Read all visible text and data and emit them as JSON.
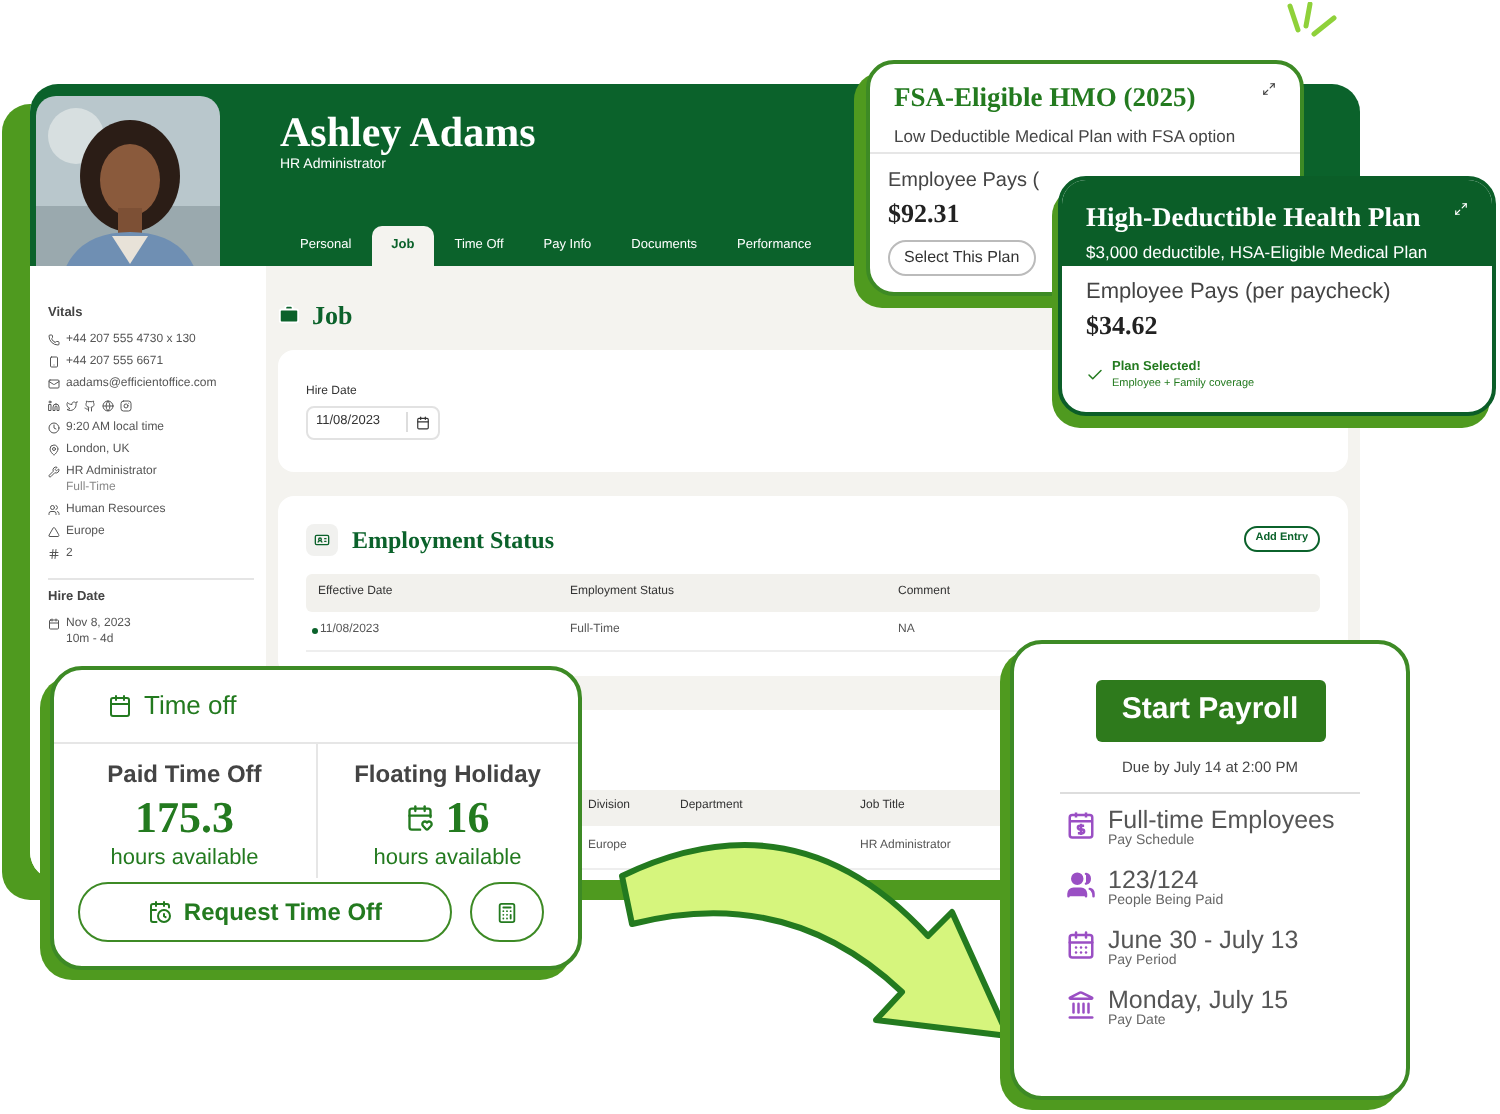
{
  "profile": {
    "name": "Ashley Adams",
    "title": "HR Administrator"
  },
  "tabs": [
    {
      "label": "Personal",
      "selected": false
    },
    {
      "label": "Job",
      "selected": true
    },
    {
      "label": "Time Off",
      "selected": false
    },
    {
      "label": "Pay Info",
      "selected": false
    },
    {
      "label": "Documents",
      "selected": false
    },
    {
      "label": "Performance",
      "selected": false
    }
  ],
  "sidebar": {
    "vitals_heading": "Vitals",
    "vitals": [
      {
        "kind": "phone",
        "lines": [
          "+44 207 555 4730 x 130"
        ]
      },
      {
        "kind": "mobile",
        "lines": [
          "+44 207 555 6671"
        ]
      },
      {
        "kind": "email",
        "lines": [
          "aadams@efficientoffice.com"
        ]
      },
      {
        "kind": "social"
      },
      {
        "kind": "clock",
        "lines": [
          "9:20 AM local time"
        ]
      },
      {
        "kind": "location",
        "lines": [
          "London, UK"
        ]
      },
      {
        "kind": "role",
        "lines": [
          "HR Administrator",
          "Full-Time"
        ]
      },
      {
        "kind": "department",
        "lines": [
          "Human Resources"
        ]
      },
      {
        "kind": "region",
        "lines": [
          "Europe"
        ]
      },
      {
        "kind": "number",
        "lines": [
          "2"
        ]
      }
    ],
    "hire_heading": "Hire Date",
    "hire_lines": [
      "Nov 8, 2023",
      "10m - 4d"
    ]
  },
  "job": {
    "heading": "Job",
    "hire_date": {
      "label": "Hire Date",
      "value": "11/08/2023"
    }
  },
  "employment_status": {
    "title": "Employment Status",
    "action": "Add Entry",
    "columns": [
      "Effective Date",
      "Employment Status",
      "Comment"
    ],
    "rows": [
      {
        "current": true,
        "cells": [
          "11/08/2023",
          "Full-Time",
          "NA"
        ]
      }
    ]
  },
  "job_information": {
    "columns": [
      "Division",
      "Department",
      "Job Title"
    ],
    "rows": [
      {
        "division": "Europe",
        "job_title": "HR Administrator"
      }
    ]
  },
  "plans": [
    {
      "selected": false,
      "title": "FSA-Eligible HMO (2025)",
      "subtitle": "Low Deductible Medical Plan with FSA option",
      "pays_label": "Employee Pays (",
      "price": "$92.31",
      "action": "Select This Plan"
    },
    {
      "selected": true,
      "title": "High-Deductible Health Plan",
      "subtitle": "$3,000 deductible, HSA-Eligible Medical Plan",
      "pays_label": "Employee Pays (per paycheck)",
      "price": "$34.62",
      "status": "Plan Selected!",
      "coverage": "Employee + Family coverage"
    }
  ],
  "time_off": {
    "title": "Time off",
    "balances": [
      {
        "kind": "pto",
        "label": "Paid Time Off",
        "value": "175.3",
        "unit": "hours available"
      },
      {
        "kind": "holiday",
        "label": "Floating Holiday",
        "value": "16",
        "unit": "hours available"
      }
    ],
    "action": "Request Time Off"
  },
  "payroll": {
    "action": "Start Payroll",
    "due": "Due by July 14 at 2:00 PM",
    "items": [
      {
        "kind": "schedule",
        "value": "Full-time Employees",
        "label": "Pay Schedule"
      },
      {
        "kind": "people",
        "value": "123/124",
        "label": "People Being Paid"
      },
      {
        "kind": "period",
        "value": "June 30 - July 13",
        "label": "Pay Period"
      },
      {
        "kind": "date",
        "value": "Monday, July 15",
        "label": "Pay Date"
      }
    ]
  }
}
